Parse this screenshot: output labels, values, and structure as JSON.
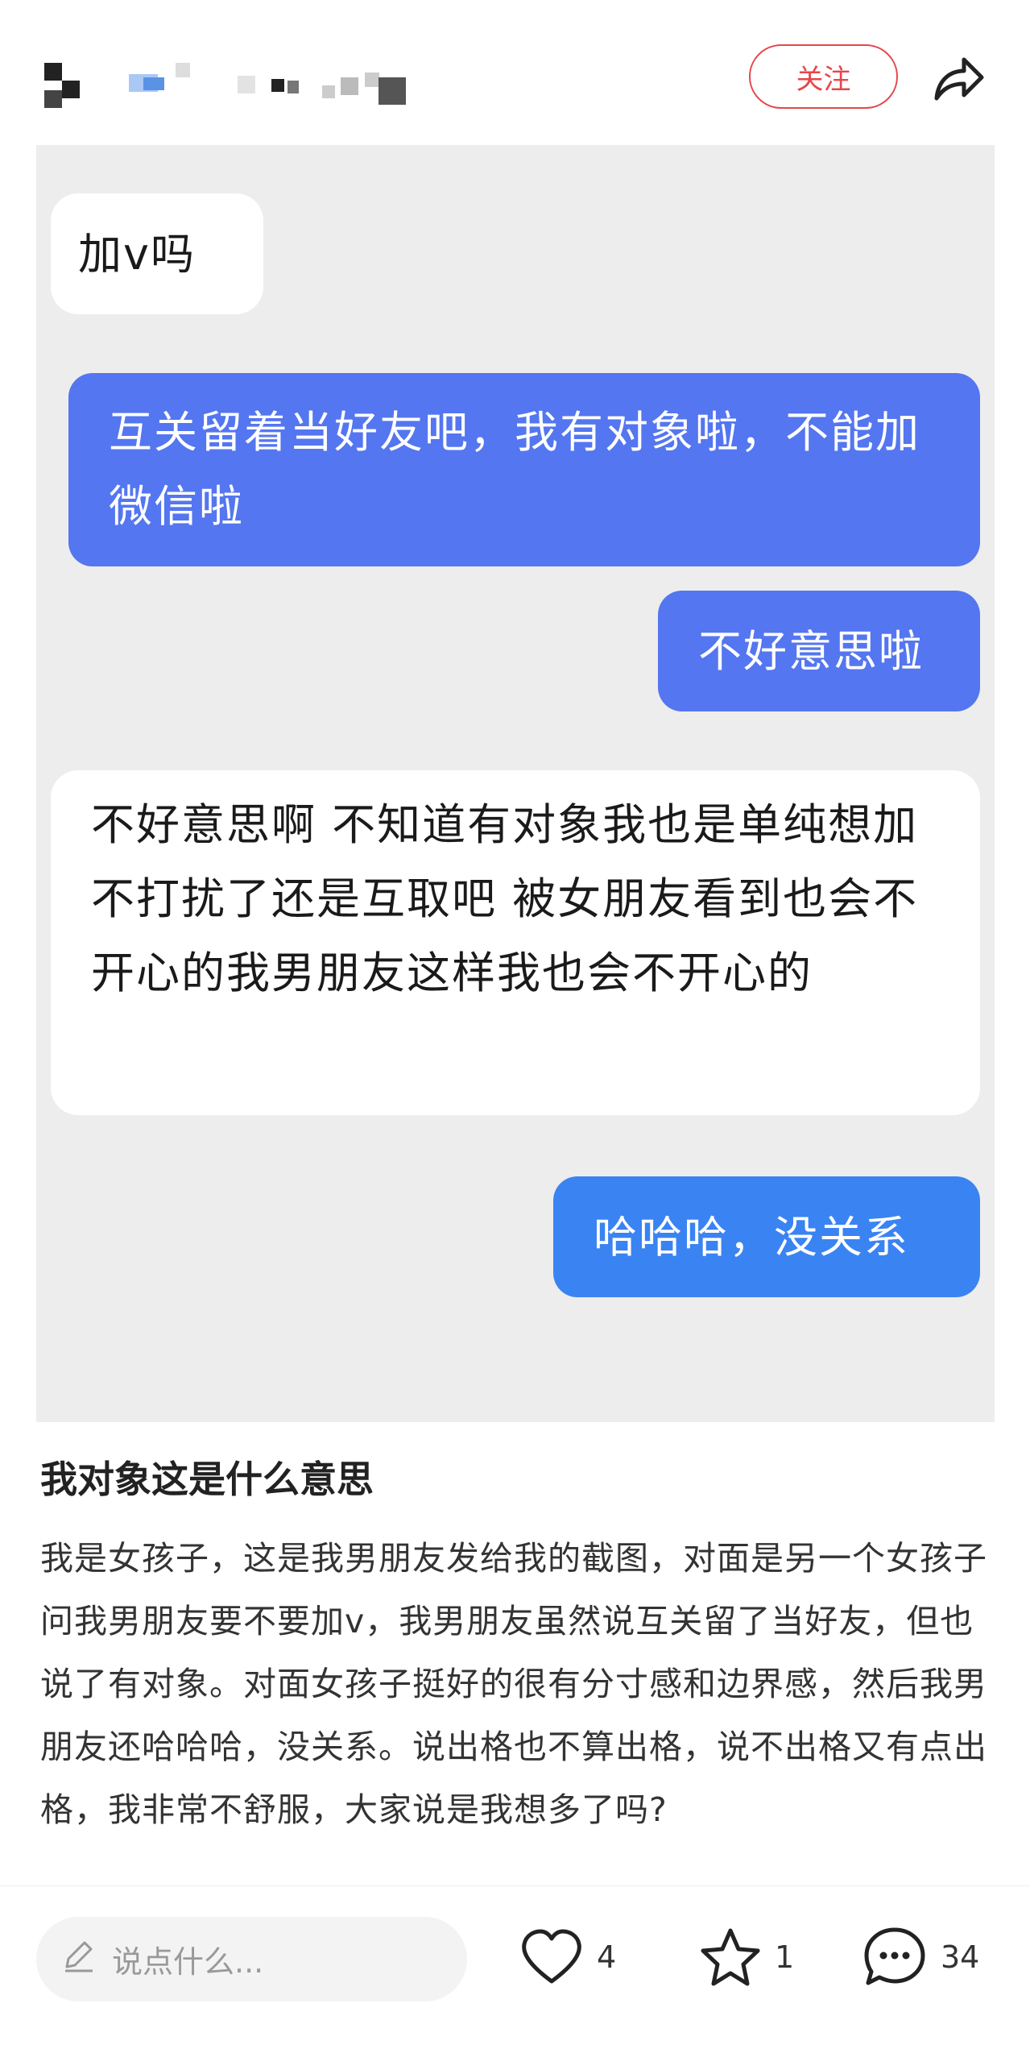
{
  "header": {
    "follow_label": "关注",
    "icons": {
      "share": "share-arrow-icon"
    }
  },
  "chat": {
    "messages": [
      {
        "side": "left",
        "style": "white",
        "text": "加v吗"
      },
      {
        "side": "right",
        "style": "blue1",
        "text": "互关留着当好友吧，我有对象啦，不能加微信啦"
      },
      {
        "side": "right",
        "style": "blue1",
        "text": "不好意思啦"
      },
      {
        "side": "left",
        "style": "white",
        "text": "不好意思啊 不知道有对象我也是单纯想加  不打扰了还是互取吧 被女朋友看到也会不开心的我男朋友这样我也会不开心的"
      },
      {
        "side": "right",
        "style": "blue2",
        "text": "哈哈哈，没关系"
      }
    ],
    "colors": {
      "background": "#ededed",
      "white_bubble": "#ffffff",
      "blue_bubble": "#5476f0",
      "blue_bubble_alt": "#3a83f2"
    }
  },
  "post": {
    "title": "我对象这是什么意思",
    "body": "我是女孩子，这是我男朋友发给我的截图，对面是另一个女孩子问我男朋友要不要加v，我男朋友虽然说互关留了当好友，但也说了有对象。对面女孩子挺好的很有分寸感和边界感，然后我男朋友还哈哈哈，没关系。说出格也不算出格，说不出格又有点出格，我非常不舒服，大家说是我想多了吗?"
  },
  "bottom_bar": {
    "comment_placeholder": "说点什么...",
    "like_count": "4",
    "favorite_count": "1",
    "comment_count": "34",
    "icons": {
      "edit": "pencil-icon",
      "like": "heart-icon",
      "favorite": "star-icon",
      "comment": "comment-bubble-icon"
    }
  },
  "colors": {
    "accent": "#e5474b"
  }
}
